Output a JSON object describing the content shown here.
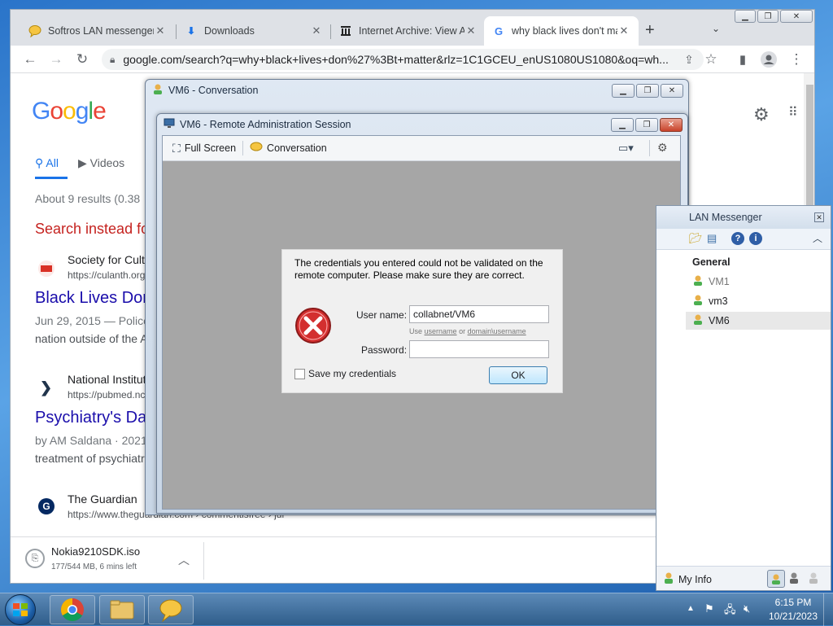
{
  "browser": {
    "tabs": [
      {
        "title": "Softros LAN messenger",
        "icon": "speech-bubble-icon"
      },
      {
        "title": "Downloads",
        "icon": "download-icon"
      },
      {
        "title": "Internet Archive: View Archive",
        "icon": "archive-icon"
      },
      {
        "title": "why black lives don't matter",
        "icon": "google-g-icon"
      }
    ],
    "new_tab": "+",
    "url": "google.com/search?q=why+black+lives+don%27%3Bt+matter&rlz=1C1GCEU_enUS1080US1080&oq=wh..."
  },
  "google": {
    "logo": "Google",
    "tabs": [
      "All",
      "Videos"
    ],
    "results_count": "About 9 results (0.38",
    "search_instead": "Search instead fo",
    "results": [
      {
        "source": "Society for Cult",
        "url": "https://culanth.org",
        "title": "Black Lives Don",
        "date": "Jun 29, 2015 — Police",
        "snippet": "nation outside of the A"
      },
      {
        "source": "National Institut",
        "url": "https://pubmed.nc",
        "title": "Psychiatry's Da",
        "date": "by AM Saldana · 2021",
        "snippet": "treatment of psychiatr"
      },
      {
        "source": "The Guardian",
        "url": "https://www.theguardian.com › commentisfree › jul"
      }
    ]
  },
  "download": {
    "filename": "Nokia9210SDK.iso",
    "progress": "177/544 MB, 6 mins left"
  },
  "conversation_window": {
    "title": "VM6 - Conversation"
  },
  "remote_session": {
    "title": "VM6 - Remote Administration Session",
    "full_screen": "Full Screen",
    "conversation": "Conversation"
  },
  "credential_dialog": {
    "message": "The credentials you entered could not be validated on the remote computer. Please make sure they are correct.",
    "username_label": "User name:",
    "username_value": "collabnet/VM6",
    "hint_use": "Use",
    "hint_username": "username",
    "hint_or": "or",
    "hint_domain": "domain\\username",
    "password_label": "Password:",
    "save_label": "Save my credentials",
    "ok": "OK"
  },
  "lan_messenger": {
    "title": "LAN Messenger",
    "group": "General",
    "users": [
      "VM1",
      "vm3",
      "VM6"
    ],
    "my_info": "My Info"
  },
  "taskbar": {
    "time": "6:15 PM",
    "date": "10/21/2023"
  },
  "colors": {
    "google_blue": "#4285f4",
    "google_red": "#ea4335",
    "google_yellow": "#fbbc05",
    "google_green": "#34a853",
    "link_blue": "#1a0dab",
    "search_instead_red": "#c5221f"
  }
}
